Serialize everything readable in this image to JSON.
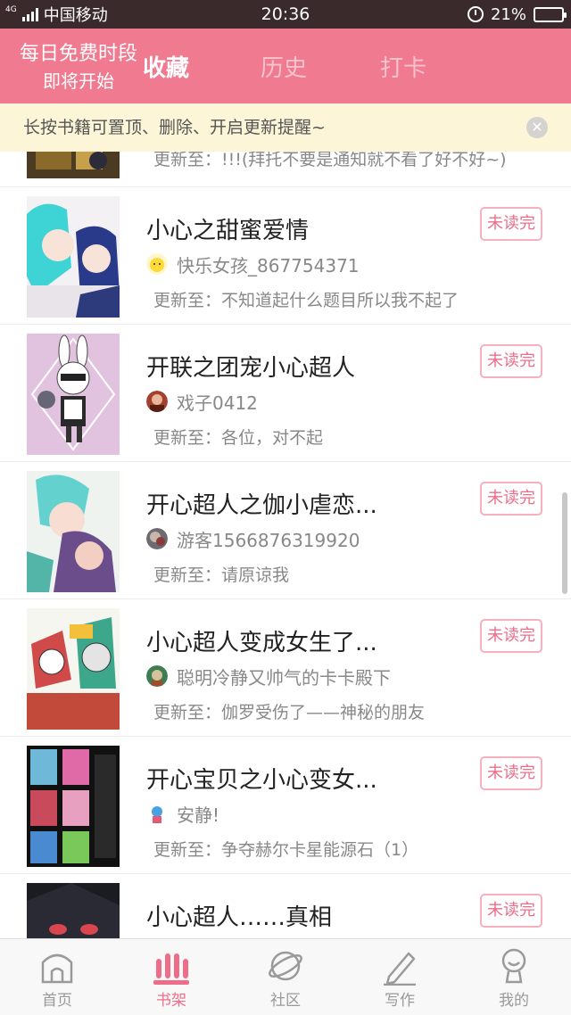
{
  "status_bar": {
    "network_type": "4G",
    "carrier": "中国移动",
    "time": "20:36",
    "battery_percent_text": "21%",
    "battery_level": 0.21,
    "icons": [
      "signal-icon",
      "alarm-icon",
      "battery-charging-icon"
    ]
  },
  "header": {
    "promo_line1": "每日免费时段",
    "promo_line2": "即将开始",
    "tabs": [
      {
        "label": "收藏",
        "active": true
      },
      {
        "label": "历史",
        "active": false
      },
      {
        "label": "打卡",
        "active": false
      }
    ],
    "background_color": "#f07a90"
  },
  "notice": {
    "text": "长按书籍可置顶、删除、开启更新提醒~",
    "close_icon": "close-icon"
  },
  "partial_item": {
    "update_text": "更新至：!!!(拜托不要是通知就不看了好不好~)"
  },
  "books": [
    {
      "title": "小心之甜蜜爱情",
      "author": "快乐女孩_867754371",
      "update_text": "更新至：不知道起什么题目所以我不起了",
      "status": "未读完"
    },
    {
      "title": "开联之团宠小心超人",
      "author": "戏子0412",
      "update_text": "更新至：各位，对不起",
      "status": "未读完"
    },
    {
      "title": "开心超人之伽小虐恋...",
      "author": "游客1566876319920",
      "update_text": "更新至：请原谅我",
      "status": "未读完"
    },
    {
      "title": "小心超人变成女生了...",
      "author": "聪明冷静又帅气的卡卡殿下",
      "update_text": "更新至：伽罗受伤了——神秘的朋友",
      "status": "未读完"
    },
    {
      "title": "开心宝贝之小心变女...",
      "author": "安静!",
      "update_text": "更新至：争夺赫尔卡星能源石（1）",
      "status": "未读完"
    },
    {
      "title": "小心超人……真相",
      "author": "",
      "update_text": "",
      "status": "未读完"
    }
  ],
  "bottom_nav": [
    {
      "label": "首页",
      "icon": "home-icon",
      "active": false
    },
    {
      "label": "书架",
      "icon": "bookshelf-icon",
      "active": true
    },
    {
      "label": "社区",
      "icon": "planet-icon",
      "active": false
    },
    {
      "label": "写作",
      "icon": "pen-icon",
      "active": false
    },
    {
      "label": "我的",
      "icon": "profile-icon",
      "active": false
    }
  ],
  "colors": {
    "accent": "#ee6d89",
    "notice_bg": "#fdf5d7"
  }
}
